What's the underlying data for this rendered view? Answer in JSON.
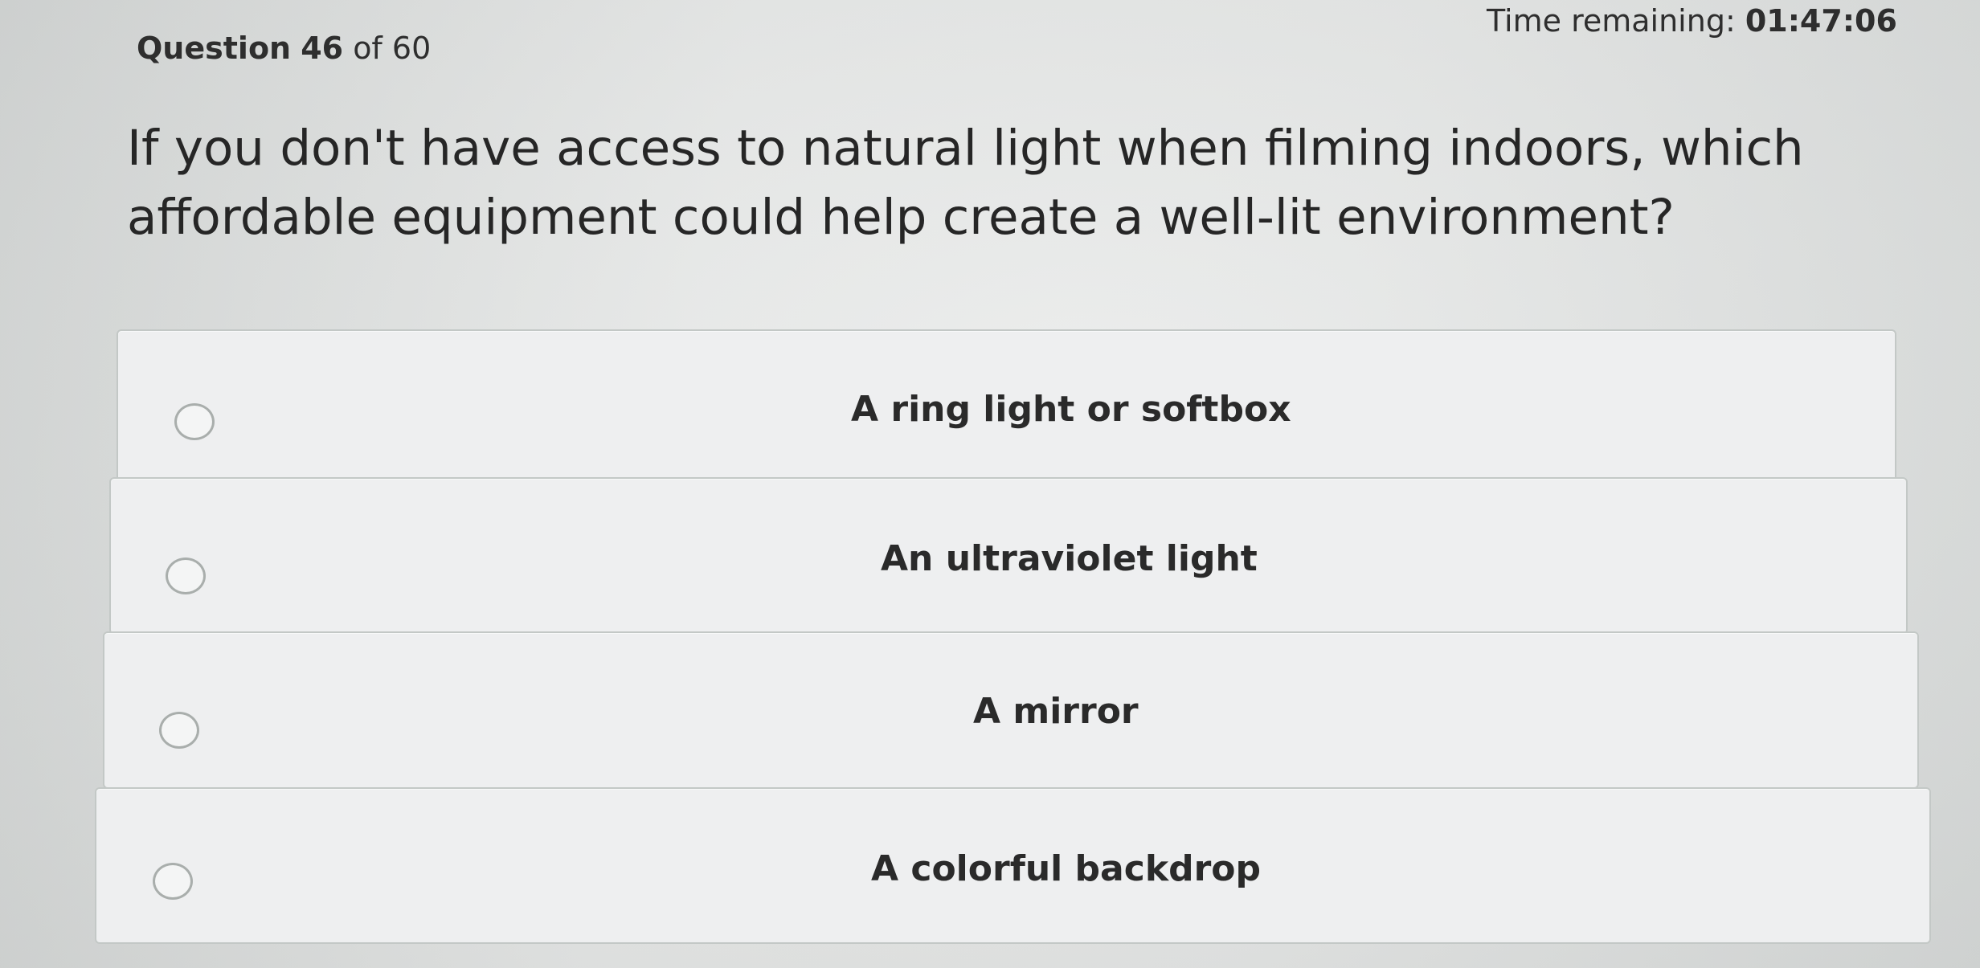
{
  "header": {
    "question_label": "Question",
    "question_number": "46",
    "question_of": "of 60",
    "timer_label": "Time remaining:",
    "timer_value": "01:47:06"
  },
  "question": {
    "text": "If you don't have access to natural light when filming indoors, which affordable equipment could help create a well-lit environment?"
  },
  "options": [
    {
      "label": "A ring light or softbox",
      "selected": false
    },
    {
      "label": "An ultraviolet light",
      "selected": false
    },
    {
      "label": "A mirror",
      "selected": false
    },
    {
      "label": "A colorful backdrop",
      "selected": false
    }
  ],
  "colors": {
    "background": "#e4e6e5",
    "option_fill": "#eeeff0",
    "option_border": "#c3c8c6",
    "text": "#2b2b2b"
  }
}
